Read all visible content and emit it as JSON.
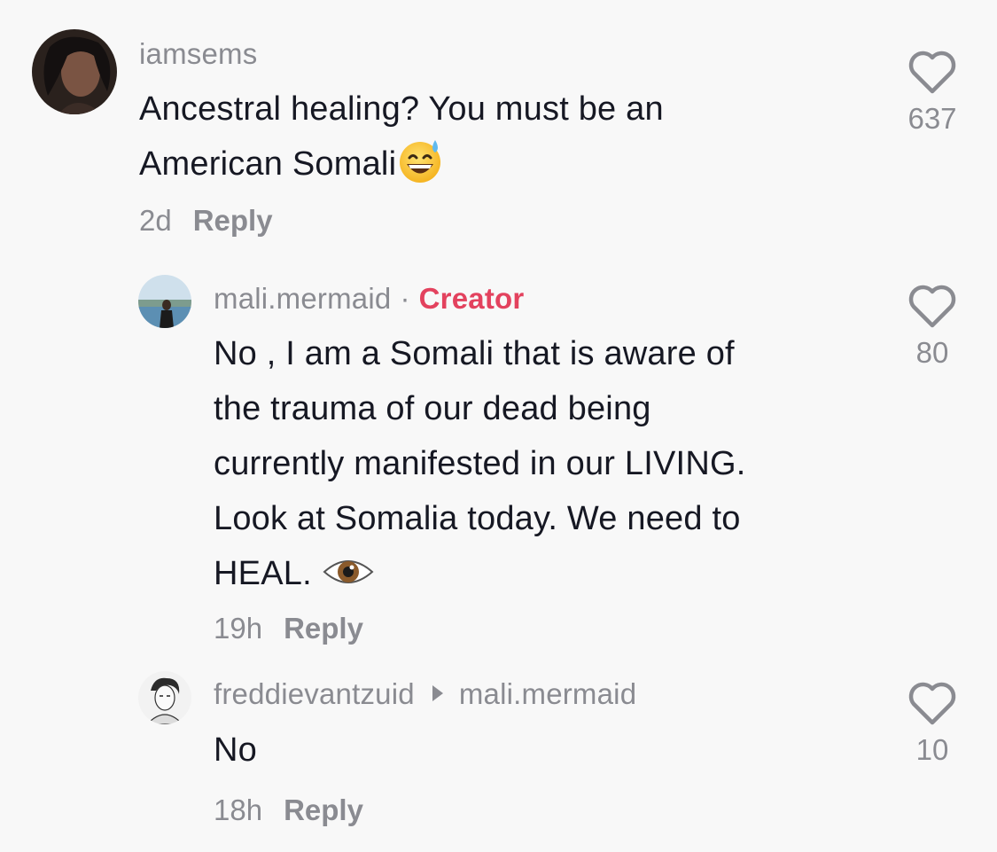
{
  "comments": [
    {
      "username": "iamsems",
      "text_line1": "Ancestral healing? You must be an",
      "text_line2": "American Somali",
      "emoji": "grinning-sweat-emoji",
      "time": "2d",
      "reply_label": "Reply",
      "likes": "637"
    },
    {
      "username": "mali.mermaid",
      "badge": "Creator",
      "badge_separator": "·",
      "lines": [
        "No , I am a Somali that is aware of",
        "the trauma of our dead being",
        "currently manifested in our LIVING.",
        "Look at Somalia today. We need to",
        "HEAL."
      ],
      "emoji": "eye-emoji",
      "time": "19h",
      "reply_label": "Reply",
      "likes": "80"
    },
    {
      "username": "freddievantzuid",
      "reply_to": "mali.mermaid",
      "text": "No",
      "time": "18h",
      "reply_label": "Reply",
      "likes": "10"
    }
  ],
  "colors": {
    "background": "#f8f8f8",
    "text": "#161823",
    "muted": "#8a8b91",
    "creator": "#e3425e"
  }
}
